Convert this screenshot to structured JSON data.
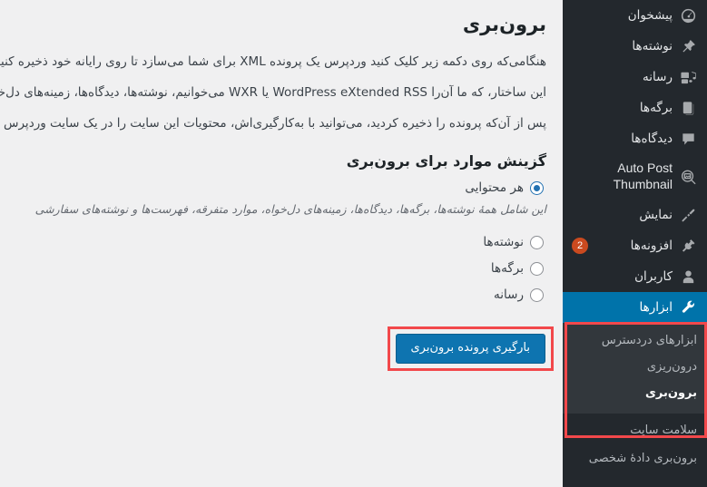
{
  "page": {
    "title": "برون‌بری",
    "paragraphs": [
      "هنگامی‌که روی دکمه زیر کلیک کنید وردپرس یک پرونده XML برای شما می‌سازد تا روی رایانه خود ذخیره کنید.",
      "این ساختار، که ما آن‌را WordPress eXtended RSS یا WXR می‌خوانیم، نوشته‌ها، دیدگاه‌ها، زمینه‌های دل‌خواه و د",
      "پس از آن‌که پرونده را ذخیره کردید، می‌توانید با به‌کارگیری‌اش، محتویات این سایت را در یک سایت وردپرس دیگر در"
    ],
    "section_title": "گزینش موارد برای برون‌بری",
    "options": [
      {
        "label": "هر محتوایی",
        "checked": true
      },
      {
        "label": "نوشته‌ها",
        "checked": false
      },
      {
        "label": "برگه‌ها",
        "checked": false
      },
      {
        "label": "رسانه",
        "checked": false
      }
    ],
    "option_note": "این شامل همهٔ نوشته‌ها، برگه‌ها، دیدگاه‌ها، زمینه‌های دل‌خواه، موارد متفرقه، فهرست‌ها و نوشته‌های سفارشی ",
    "submit_label": "بارگیری پرونده برون‌بری"
  },
  "sidebar": {
    "items": [
      {
        "label": "پیشخوان",
        "icon": "dashboard-icon"
      },
      {
        "label": "نوشته‌ها",
        "icon": "pushpin-icon"
      },
      {
        "label": "رسانه",
        "icon": "media-icon"
      },
      {
        "label": "برگه‌ها",
        "icon": "pages-icon"
      },
      {
        "label": "دیدگاه‌ها",
        "icon": "comment-icon"
      },
      {
        "label": "Auto Post Thumbnail",
        "icon": "image-search-icon",
        "two_line": true
      },
      {
        "label": "نمایش",
        "icon": "paintbrush-icon"
      },
      {
        "label": "افزونه‌ها",
        "icon": "plugin-icon",
        "badge": "2"
      },
      {
        "label": "کاربران",
        "icon": "user-icon"
      },
      {
        "label": "ابزارها",
        "icon": "wrench-icon",
        "current": true
      }
    ],
    "submenu": [
      {
        "label": "ابزارهای دردسترس",
        "current": false
      },
      {
        "label": "درون‌ریزی",
        "current": false
      },
      {
        "label": "برون‌بری",
        "current": true
      }
    ],
    "tail": [
      {
        "label": "سلامت سایت"
      },
      {
        "label": "برون‌بری دادهٔ شخصی"
      }
    ]
  },
  "colors": {
    "sidebar_bg": "#23282d",
    "submenu_bg": "#32373c",
    "active_blue": "#0073aa",
    "button_blue": "#0e74b0",
    "highlight_red": "#f2484b",
    "badge_orange": "#ca4a1f",
    "content_bg": "#f0f0f1"
  }
}
